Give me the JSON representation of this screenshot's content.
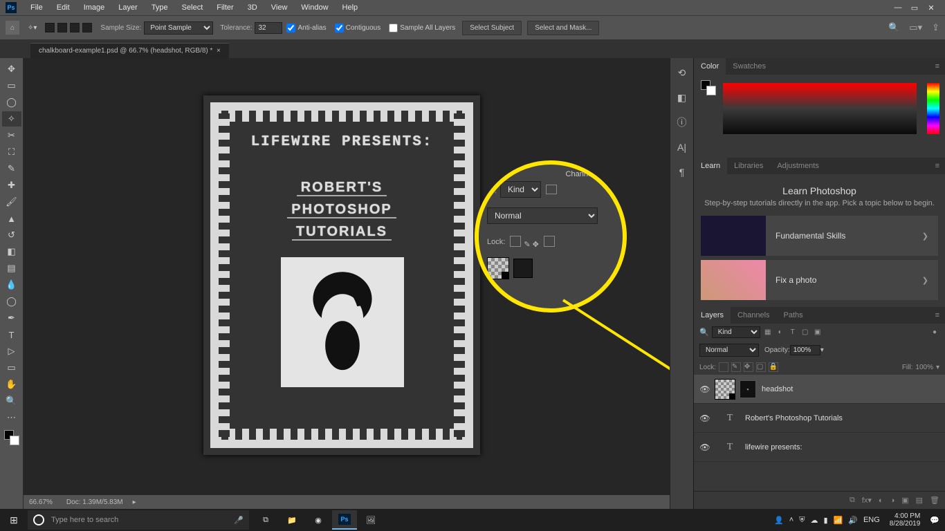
{
  "menu": {
    "items": [
      "File",
      "Edit",
      "Image",
      "Layer",
      "Type",
      "Select",
      "Filter",
      "3D",
      "View",
      "Window",
      "Help"
    ]
  },
  "options": {
    "sample_size_label": "Sample Size:",
    "sample_size": "Point Sample",
    "tolerance_label": "Tolerance:",
    "tolerance": "32",
    "anti_alias": "Anti-alias",
    "contiguous": "Contiguous",
    "sample_all": "Sample All Layers",
    "select_subject": "Select Subject",
    "select_mask": "Select and Mask..."
  },
  "tab": "chalkboard-example1.psd @ 66.7% (headshot, RGB/8) *",
  "canvas": {
    "title1": "LIFEWIRE PRESENTS:",
    "title2a": "ROBERT'S",
    "title2b": "PHOTOSHOP",
    "title2c": "TUTORIALS"
  },
  "status": {
    "zoom": "66.67%",
    "docinfo": "Doc: 1.39M/5.83M"
  },
  "mag": {
    "channels": "Channels",
    "kind": "Kind",
    "normal": "Normal",
    "lock": "Lock:"
  },
  "rp": {
    "color": "Color",
    "swatches": "Swatches",
    "learn": "Learn",
    "libraries": "Libraries",
    "adjustments": "Adjustments",
    "learn_title": "Learn Photoshop",
    "learn_sub": "Step-by-step tutorials directly in the app. Pick a topic below to begin.",
    "lesson1": "Fundamental Skills",
    "lesson2": "Fix a photo",
    "layers": "Layers",
    "channels_tab": "Channels",
    "paths": "Paths",
    "kind": "Kind",
    "normal": "Normal",
    "opacity_lbl": "Opacity:",
    "opacity": "100%",
    "lock": "Lock:",
    "fill_lbl": "Fill:",
    "fill": "100%"
  },
  "layers": [
    {
      "name": "headshot"
    },
    {
      "name": "Robert's Photoshop Tutorials"
    },
    {
      "name": "lifewire presents:"
    }
  ],
  "taskbar": {
    "search_placeholder": "Type here to search",
    "lang": "ENG",
    "time": "4:00 PM",
    "date": "8/28/2019"
  }
}
